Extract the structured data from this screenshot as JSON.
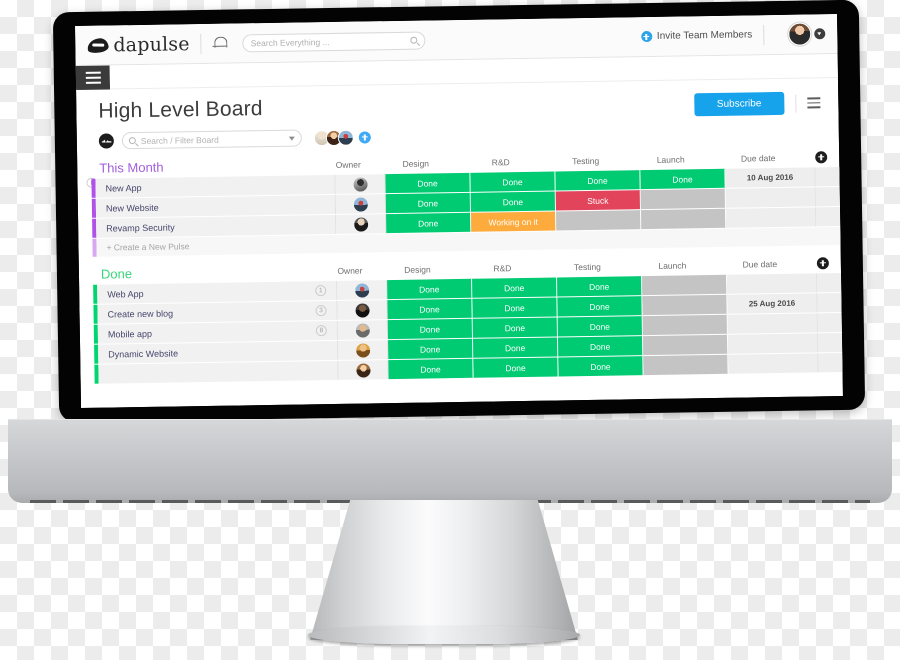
{
  "topbar": {
    "brand": "dapulse",
    "bell_icon": "bell-icon",
    "search": {
      "placeholder": "Search Everything ...",
      "icon": "search-icon",
      "value": ""
    },
    "invite_label": "Invite Team Members",
    "invite_icon": "plus-circle-icon",
    "user_avatar": "avatar",
    "user_caret_icon": "chevron-down-icon"
  },
  "menu_tab_icon": "hamburger-icon",
  "board": {
    "title": "High Level Board",
    "subscribe_label": "Subscribe",
    "board_menu_icon": "hamburger-icon",
    "toolbar": {
      "logo_icon": "pulse-logo-icon",
      "filter": {
        "placeholder": "Search / Filter Board",
        "value": "",
        "icon": "search-icon",
        "chevron_icon": "chevron-down-icon"
      },
      "member_count": 3,
      "add_member_icon": "plus-circle-icon"
    },
    "collapse_handle": "i",
    "columns": [
      "Owner",
      "Design",
      "R&D",
      "Testing",
      "Launch",
      "Due date"
    ],
    "add_column_icon": "plus-circle-icon",
    "status_colors": {
      "done": "#00ca72",
      "stuck": "#e2445c",
      "working": "#fdab3d",
      "empty": "#c4c4c4"
    },
    "groups": [
      {
        "name": "This Month",
        "color": "#a25ddc",
        "row_color": "#b052e8",
        "create_label": "+ Create a New Pulse",
        "rows": [
          {
            "name": "New App",
            "count": "",
            "avatar": "av-a",
            "design": "Done",
            "rnd": "Done",
            "testing": "Done",
            "launch": "Done",
            "due": "10 Aug 2016"
          },
          {
            "name": "New Website",
            "count": "",
            "avatar": "av-b",
            "design": "Done",
            "rnd": "Done",
            "testing": "Stuck",
            "launch": "",
            "due": ""
          },
          {
            "name": "Revamp Security",
            "count": "",
            "avatar": "av-c",
            "design": "Done",
            "rnd": "Working on it",
            "testing": "",
            "launch": "",
            "due": ""
          }
        ]
      },
      {
        "name": "Done",
        "color": "#37d67a",
        "row_color": "#00d66f",
        "create_label": "",
        "rows": [
          {
            "name": "Web App",
            "count": "1",
            "avatar": "av-b",
            "design": "Done",
            "rnd": "Done",
            "testing": "Done",
            "launch": "",
            "due": ""
          },
          {
            "name": "Create new blog",
            "count": "3",
            "avatar": "av-d",
            "design": "Done",
            "rnd": "Done",
            "testing": "Done",
            "launch": "",
            "due": "25 Aug 2016"
          },
          {
            "name": "Mobile app",
            "count": "8",
            "avatar": "av-e",
            "design": "Done",
            "rnd": "Done",
            "testing": "Done",
            "launch": "",
            "due": ""
          },
          {
            "name": "Dynamic Website",
            "count": "",
            "avatar": "av-f",
            "design": "Done",
            "rnd": "Done",
            "testing": "Done",
            "launch": "",
            "due": ""
          },
          {
            "name": "",
            "count": "",
            "avatar": "av-g",
            "design": "Done",
            "rnd": "Done",
            "testing": "Done",
            "launch": "",
            "due": ""
          }
        ]
      }
    ]
  }
}
